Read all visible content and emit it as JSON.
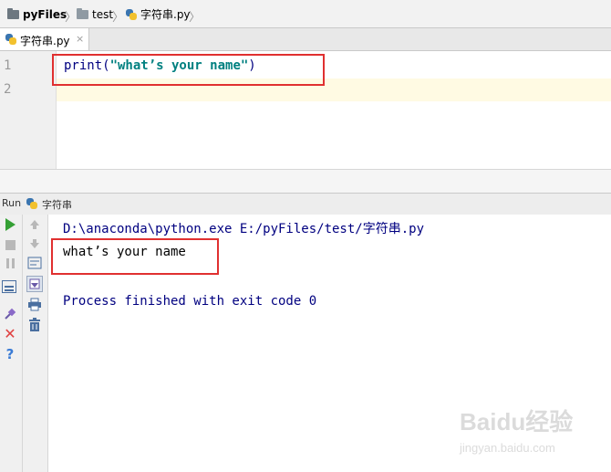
{
  "breadcrumb": {
    "project": "pyFiles",
    "folder": "test",
    "file": "字符串.py"
  },
  "tab": {
    "label": "字符串.py",
    "close": "×"
  },
  "editor": {
    "line_numbers": [
      "1",
      "2"
    ],
    "code_line1_fn": "print(",
    "code_line1_str": "\"what’s your name\"",
    "code_line1_end": ")"
  },
  "run": {
    "title": "Run",
    "config_name": "字符串"
  },
  "console": {
    "command": "D:\\anaconda\\python.exe E:/pyFiles/test/字符串.py",
    "output": "what’s your name",
    "exit": "Process finished with exit code 0"
  },
  "watermark": {
    "brand": "Baidu经验",
    "url": "jingyan.baidu.com"
  },
  "colors": {
    "highlight_box": "#e03030",
    "console_text": "#000080",
    "run_green": "#3aa03a"
  },
  "icons": [
    "folder-icon",
    "python-file-icon",
    "close-icon",
    "run-icon",
    "stop-icon",
    "pause-icon",
    "up-arrow-icon",
    "down-arrow-icon",
    "soft-wrap-icon",
    "scroll-to-end-icon",
    "print-icon",
    "trash-icon",
    "restore-layout-icon",
    "pin-icon",
    "close-run-icon",
    "help-icon"
  ]
}
